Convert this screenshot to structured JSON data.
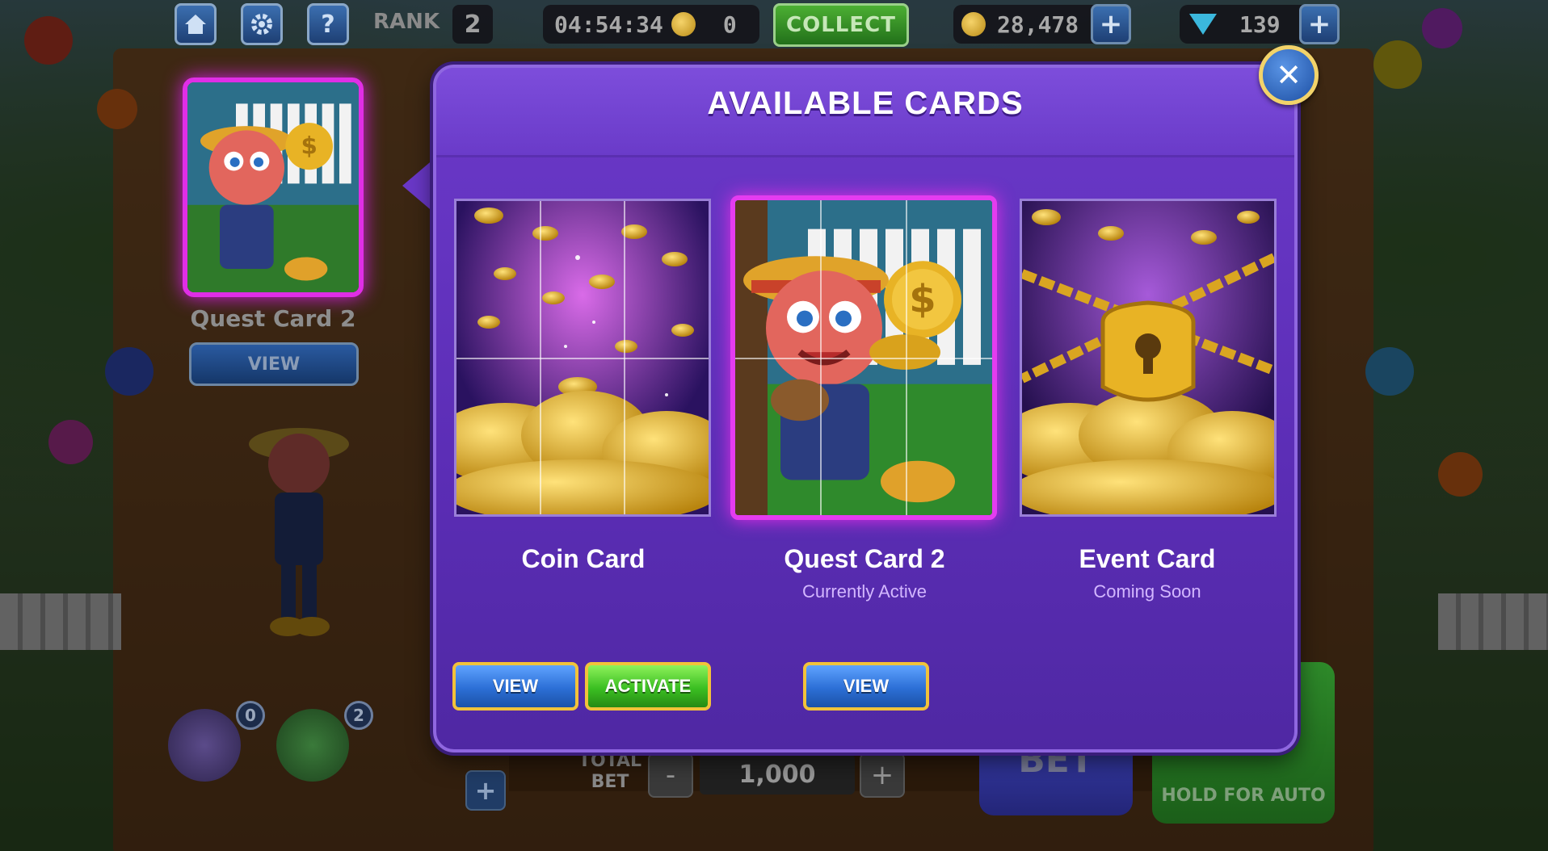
{
  "topbar": {
    "rank_label": "RANK",
    "rank_value": "2",
    "timer": "04:54:34",
    "timer_coins": "0",
    "collect_label": "COLLECT",
    "coins": "28,478",
    "gems": "139"
  },
  "side_panel": {
    "card_title": "Quest Card 2",
    "view_label": "VIEW"
  },
  "bottom": {
    "total_bet_label": "TOTAL\nBET",
    "bet_minus": "-",
    "bet_value": "1,000",
    "bet_plus": "+",
    "bet_label": "BET",
    "auto_label": "HOLD FOR AUTO",
    "token1_badge": "0",
    "token2_badge": "2",
    "side_plus": "+"
  },
  "modal": {
    "title": "AVAILABLE CARDS",
    "close_glyph": "✕",
    "cards": [
      {
        "name": "Coin Card",
        "status": "",
        "buttons": [
          "VIEW",
          "ACTIVATE"
        ]
      },
      {
        "name": "Quest Card 2",
        "status": "Currently Active",
        "buttons": [
          "VIEW"
        ]
      },
      {
        "name": "Event Card",
        "status": "Coming Soon",
        "buttons": []
      }
    ]
  },
  "colors": {
    "modal_bg": "#5b2db5",
    "active_glow": "#e43cf0",
    "button_border": "#f2c23a",
    "blue_button": "#2c6fd6",
    "green_button": "#3bbf22"
  },
  "icons": {
    "home": "home-icon",
    "settings": "gear-icon",
    "help": "question-icon",
    "coin": "coin-icon",
    "gem": "diamond-icon",
    "close": "close-icon"
  }
}
